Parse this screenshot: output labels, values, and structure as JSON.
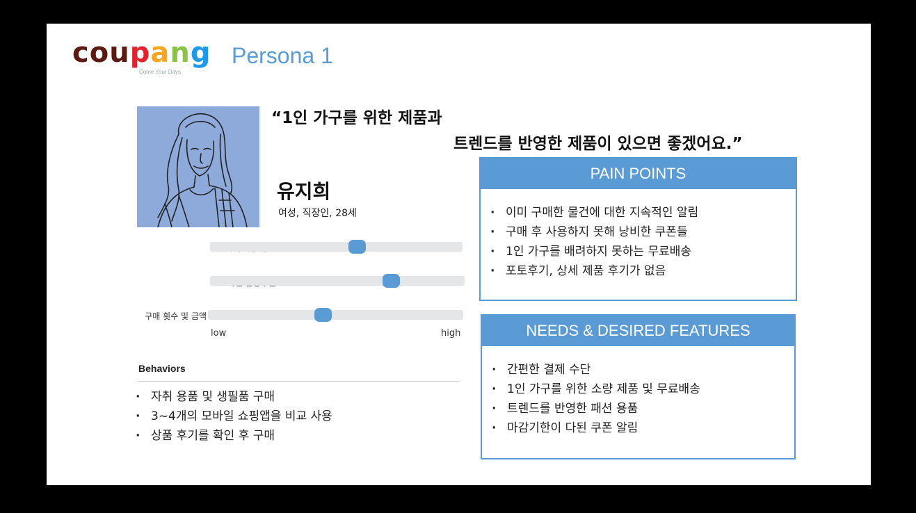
{
  "logo": {
    "word": "coupang",
    "tagline": "Come Your Days",
    "letter_colors": [
      "#5c1a12",
      "#5c1a12",
      "#5c1a12",
      "#e4222e",
      "#f5a623",
      "#8bc34a",
      "#1e9be8"
    ]
  },
  "persona_title": "Persona 1",
  "quote": {
    "line1": "“1인 가구를 위한 제품과",
    "line2": "트렌드를 반영한 제품이 있으면 좋겠어요.”"
  },
  "persona": {
    "name": "유지희",
    "info": "여성, 직장인, 28세"
  },
  "sliders": [
    {
      "label": "쿠팡사용 정도",
      "level": 0.58
    },
    {
      "label": "모바일 활용수준",
      "level": 0.71
    },
    {
      "label": "구매 횟수 및 금액",
      "level": 0.45
    }
  ],
  "scale": {
    "low": "low",
    "high": "high"
  },
  "behaviors": {
    "title": "Behaviors",
    "items": [
      "자취 용품 및 생필품 구매",
      "3~4개의 모바일 쇼핑앱을 비교 사용",
      "상품 후기를 확인 후 구매"
    ]
  },
  "pain_points": {
    "title": "PAIN POINTS",
    "items": [
      "이미 구매한 물건에 대한 지속적인 알림",
      "구매 후 사용하지 못해 낭비한 쿠폰들",
      "1인 가구를 배려하지 못하는 무료배송",
      "포토후기, 상세 제품 후기가 없음"
    ]
  },
  "needs": {
    "title": "NEEDS & DESIRED FEATURES",
    "items": [
      "간편한 결제 수단",
      "1인 가구를 위한 소량 제품 및 무료배송",
      "트렌드를 반영한 패션 용품",
      "마감기한이 다된 쿠폰 알림"
    ]
  },
  "colors": {
    "accent": "#5b9bd5",
    "photo_bg": "#8eaadb"
  }
}
